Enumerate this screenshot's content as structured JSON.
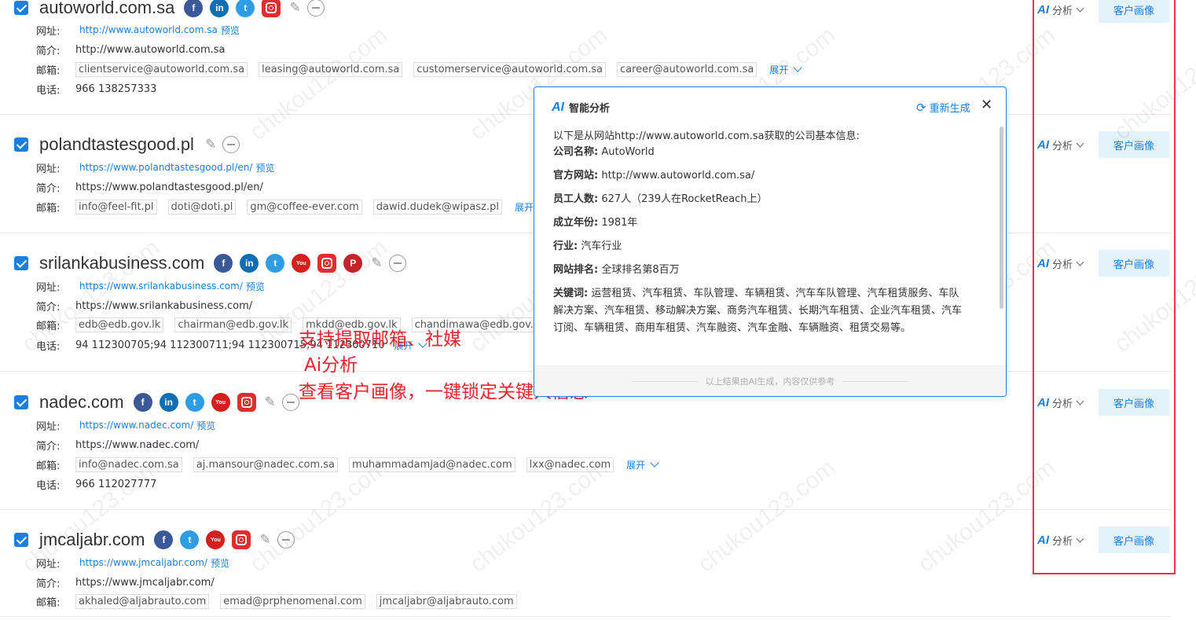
{
  "watermark": "chukou123.com",
  "labels": {
    "website": "网址:",
    "intro": "简介:",
    "email": "邮箱:",
    "phone": "电话:",
    "preview": "预览",
    "expand": "展开",
    "ai_analyze": "分析",
    "ai_logo": "AI",
    "customer_portrait": "客户画像"
  },
  "companies": [
    {
      "domain": "autoworld.com.sa",
      "url": "http://www.autoworld.com.sa",
      "intro": "http://www.autoworld.com.sa",
      "emails": [
        "clientservice@autoworld.com.sa",
        "leasing@autoworld.com.sa",
        "customerservice@autoworld.com.sa",
        "career@autoworld.com.sa"
      ],
      "phone": "966 138257333"
    },
    {
      "domain": "polandtastesgood.pl",
      "url": "https://www.polandtastesgood.pl/en/",
      "intro": "https://www.polandtastesgood.pl/en/",
      "emails": [
        "info@feel-fit.pl",
        "doti@doti.pl",
        "gm@coffee-ever.com",
        "dawid.dudek@wipasz.pl"
      ]
    },
    {
      "domain": "srilankabusiness.com",
      "url": "https://www.srilankabusiness.com/",
      "intro": "https://www.srilankabusiness.com/",
      "emails": [
        "edb@edb.gov.lk",
        "chairman@edb.gov.lk",
        "mkdd@edb.gov.lk",
        "chandimawa@edb.gov.lk"
      ],
      "phone": "94 112300705;94 112300711;94 112300715;94 112300710"
    },
    {
      "domain": "nadec.com",
      "url": "https://www.nadec.com/",
      "intro": "https://www.nadec.com/",
      "emails": [
        "info@nadec.com.sa",
        "aj.mansour@nadec.com.sa",
        "muhammadamjad@nadec.com",
        "lxx@nadec.com"
      ],
      "phone": "966 112027777"
    },
    {
      "domain": "jmcaljabr.com",
      "url": "https://www.jmcaljabr.com/",
      "intro": "https://www.jmcaljabr.com/",
      "emails": [
        "akhaled@aljabrauto.com",
        "emad@prphenomenal.com",
        "jmcaljabr@aljabrauto.com"
      ]
    }
  ],
  "annotation": {
    "line1": "支持提取邮箱、社媒",
    "line2": "Ai分析",
    "line3": "查看客户画像，一键锁定关键人信息"
  },
  "ai_panel": {
    "logo": "AI",
    "title": "智能分析",
    "regenerate": "重新生成",
    "close": "✕",
    "intro": "以下是从网站http://www.autoworld.com.sa获取的公司基本信息:",
    "fields": [
      {
        "key": "公司名称:",
        "value": "AutoWorld"
      },
      {
        "key": "官方网站:",
        "value": "http://www.autoworld.com.sa/"
      },
      {
        "key": "员工人数:",
        "value": "627人（239人在RocketReach上）"
      },
      {
        "key": "成立年份:",
        "value": "1981年"
      },
      {
        "key": "行业:",
        "value": "汽车行业"
      },
      {
        "key": "网站排名:",
        "value": "全球排名第8百万"
      },
      {
        "key": "关键词:",
        "value": "运营租赁、汽车租赁、车队管理、车辆租赁、汽车车队管理、汽车租赁服务、车队解决方案、汽车租赁、移动解决方案、商务汽车租赁、长期汽车租赁、企业汽车租赁、汽车订阅、车辆租赁、商用车租赁、汽车融资、汽车金融、车辆融资、租赁交易等。"
      }
    ],
    "footer": "以上结果由AI生成，内容仅供参考"
  }
}
